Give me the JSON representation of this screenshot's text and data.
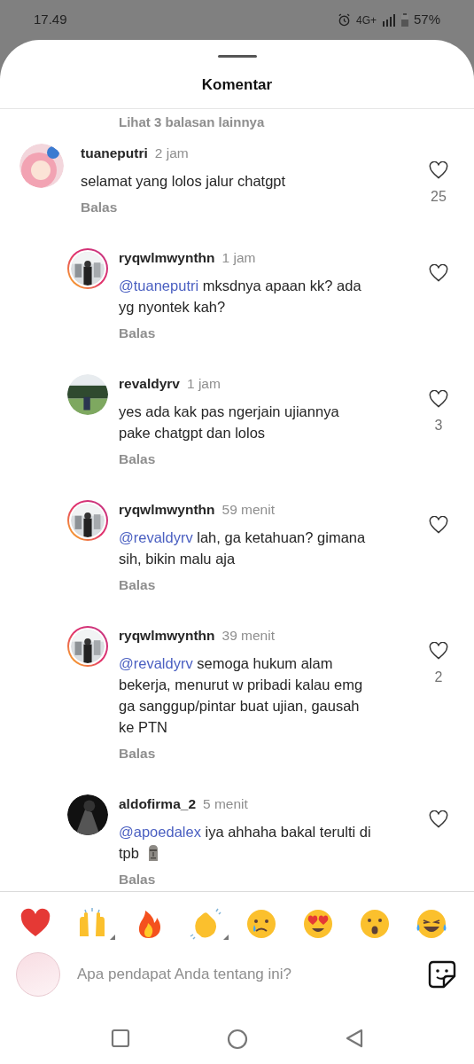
{
  "status_bar": {
    "time": "17.49",
    "network": "4G+",
    "battery": "57%"
  },
  "header": {
    "title": "Komentar"
  },
  "hidden_replies_link": "Lihat 3 balasan lainnya",
  "comments": [
    {
      "username": "tuaneputri",
      "time": "2 jam",
      "text": "selamat yang lolos jalur chatgpt",
      "reply_label": "Balas",
      "likes": "25",
      "liked": false,
      "is_reply": false,
      "story_ring": false,
      "emoji_icon": false
    },
    {
      "username": "ryqwlmwynthn",
      "time": "1 jam",
      "mention": "@tuaneputri",
      "text": "mksdnya apaan kk? ada yg nyontek kah?",
      "reply_label": "Balas",
      "liked": false,
      "is_reply": true,
      "story_ring": true,
      "emoji_icon": false
    },
    {
      "username": "revaldyrv",
      "time": "1 jam",
      "text": "yes ada kak pas ngerjain ujiannya pake chatgpt dan lolos",
      "reply_label": "Balas",
      "likes": "3",
      "liked": false,
      "is_reply": true,
      "story_ring": false,
      "emoji_icon": false
    },
    {
      "username": "ryqwlmwynthn",
      "time": "59 menit",
      "mention": "@revaldyrv",
      "text": "lah, ga ketahuan? gimana sih, bikin malu aja",
      "reply_label": "Balas",
      "liked": false,
      "is_reply": true,
      "story_ring": true,
      "emoji_icon": false
    },
    {
      "username": "ryqwlmwynthn",
      "time": "39 menit",
      "mention": "@revaldyrv",
      "text": "semoga hukum alam bekerja, menurut w pribadi kalau emg ga sanggup/pintar buat ujian, gausah ke PTN",
      "reply_label": "Balas",
      "likes": "2",
      "liked": false,
      "is_reply": true,
      "story_ring": true,
      "emoji_icon": false
    },
    {
      "username": "aldofirma_2",
      "time": "5 menit",
      "mention": "@apoedalex",
      "text": "iya ahhaha bakal terulti di tpb",
      "reply_label": "Balas",
      "liked": false,
      "is_reply": true,
      "story_ring": false,
      "emoji_icon": true
    }
  ],
  "emoji_bar": [
    {
      "kind": "heart",
      "has_variants": false
    },
    {
      "kind": "raised_hands",
      "has_variants": true
    },
    {
      "kind": "fire",
      "has_variants": false
    },
    {
      "kind": "clap",
      "has_variants": true
    },
    {
      "kind": "crying",
      "has_variants": false
    },
    {
      "kind": "heart_eyes",
      "has_variants": false
    },
    {
      "kind": "surprised",
      "has_variants": false
    },
    {
      "kind": "laughing",
      "has_variants": false
    }
  ],
  "composer": {
    "placeholder": "Apa pendapat Anda tentang ini?"
  }
}
